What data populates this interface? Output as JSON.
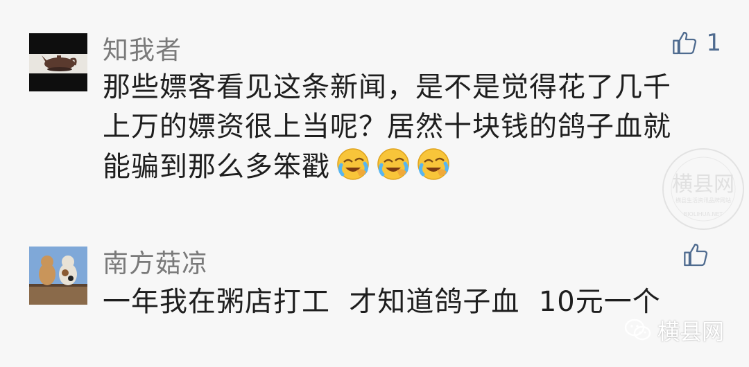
{
  "comments": [
    {
      "username": "知我者",
      "lines": [
        "那些嫖客看见这条新闻，是不是觉得花了几千",
        "上万的嫖资很上当呢？居然十块钱的鸽子血就",
        "能骗到那么多笨戳"
      ],
      "emoji": [
        "tears-of-joy-emoji",
        "tears-of-joy-emoji",
        "tears-of-joy-emoji"
      ],
      "like_count": "1"
    },
    {
      "username": "南方菇凉",
      "lines": [
        "一年我在粥店打工  才知道鸽子血  10元一个"
      ],
      "like_count": ""
    }
  ],
  "watermark": {
    "main": "横县网",
    "sub": "横县生活资讯品牌网站",
    "domain": "BIOLIHUA.NET"
  },
  "brand": {
    "label": "横县网",
    "icon": "wechat-icon"
  },
  "colors": {
    "background": "#f7f7f7",
    "text": "#1e1e1e",
    "username": "#7a7a7a",
    "like_icon": "#4f6b8f"
  }
}
